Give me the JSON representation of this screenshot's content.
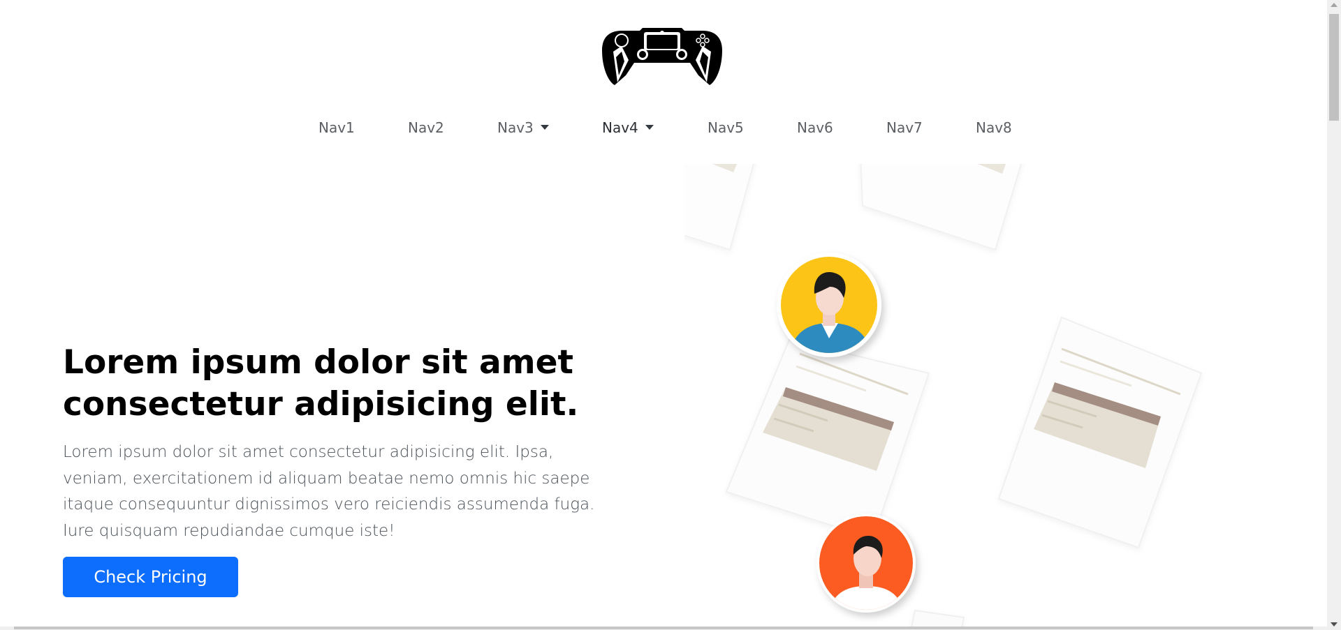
{
  "nav": {
    "items": [
      {
        "label": "Nav1",
        "dropdown": false
      },
      {
        "label": "Nav2",
        "dropdown": false
      },
      {
        "label": "Nav3",
        "dropdown": true
      },
      {
        "label": "Nav4",
        "dropdown": true
      },
      {
        "label": "Nav5",
        "dropdown": false
      },
      {
        "label": "Nav6",
        "dropdown": false
      },
      {
        "label": "Nav7",
        "dropdown": false
      },
      {
        "label": "Nav8",
        "dropdown": false
      }
    ]
  },
  "hero": {
    "title": "Lorem ipsum dolor sit amet consectetur adipisicing elit.",
    "body": "Lorem ipsum dolor sit amet consectetur adipisicing elit. Ipsa, veniam, exercitationem id aliquam beatae nemo omnis hic saepe itaque consequuntur dignissimos vero reiciendis assumenda fuga. Iure quisquam repudiandae cumque iste!",
    "cta_label": "Check Pricing"
  },
  "icons": {
    "logo": "gamepad-logo-icon",
    "avatar_top": "person-avatar-icon",
    "avatar_bottom": "person-avatar-icon"
  },
  "colors": {
    "primary": "#0d6efd",
    "avatar_yellow": "#fbc416",
    "avatar_orange": "#fc5c23"
  }
}
